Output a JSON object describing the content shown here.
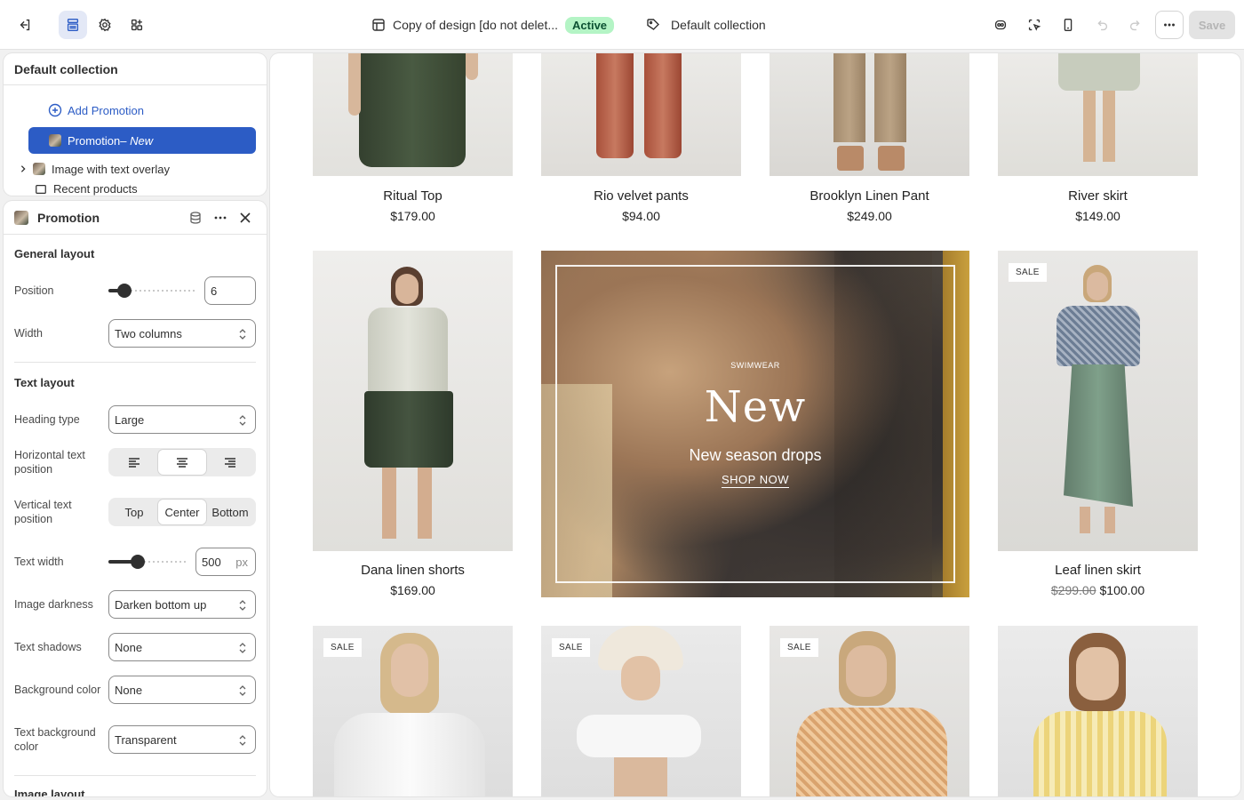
{
  "topbar": {
    "theme_name": "Copy of design [do not delet...",
    "status_badge": "Active",
    "collection": "Default collection",
    "save_label": "Save"
  },
  "sections_panel": {
    "title": "Default collection",
    "add_promotion": "Add Promotion",
    "promotion_item": "Promotion",
    "promotion_suffix": " – New",
    "image_overlay_item": "Image with text overlay",
    "recent_products_item": "Recent products"
  },
  "settings": {
    "title": "Promotion",
    "general_layout": "General layout",
    "position_label": "Position",
    "position_value": "6",
    "position_fraction": 0.12,
    "width_label": "Width",
    "width_value": "Two columns",
    "text_layout": "Text layout",
    "heading_type_label": "Heading type",
    "heading_type_value": "Large",
    "h_text_pos_label": "Horizontal text position",
    "v_text_pos_label": "Vertical text position",
    "v_options": [
      "Top",
      "Center",
      "Bottom"
    ],
    "text_width_label": "Text width",
    "text_width_value": "500",
    "text_width_unit": "px",
    "text_width_fraction": 0.35,
    "image_darkness_label": "Image darkness",
    "image_darkness_value": "Darken bottom up",
    "text_shadows_label": "Text shadows",
    "text_shadows_value": "None",
    "bg_color_label": "Background color",
    "bg_color_value": "None",
    "text_bg_color_label": "Text background color",
    "text_bg_color_value": "Transparent",
    "image_layout": "Image layout"
  },
  "products": [
    {
      "name": "Ritual Top",
      "price": "$179.00"
    },
    {
      "name": "Rio velvet pants",
      "price": "$94.00"
    },
    {
      "name": "Brooklyn Linen Pant",
      "price": "$249.00"
    },
    {
      "name": "River skirt",
      "price": "$149.00"
    },
    {
      "name": "Dana linen shorts",
      "price": "$169.00"
    },
    {
      "name": "Leaf linen skirt",
      "old_price": "$299.00",
      "price": "$100.00"
    }
  ],
  "sale_label": "SALE",
  "promo": {
    "eyebrow": "SWIMWEAR",
    "heading": "New",
    "subheading": "New season drops",
    "cta": "SHOP NOW"
  },
  "colors": {
    "accent": "#2c5cc5",
    "active_badge": "#b4f4c5"
  }
}
